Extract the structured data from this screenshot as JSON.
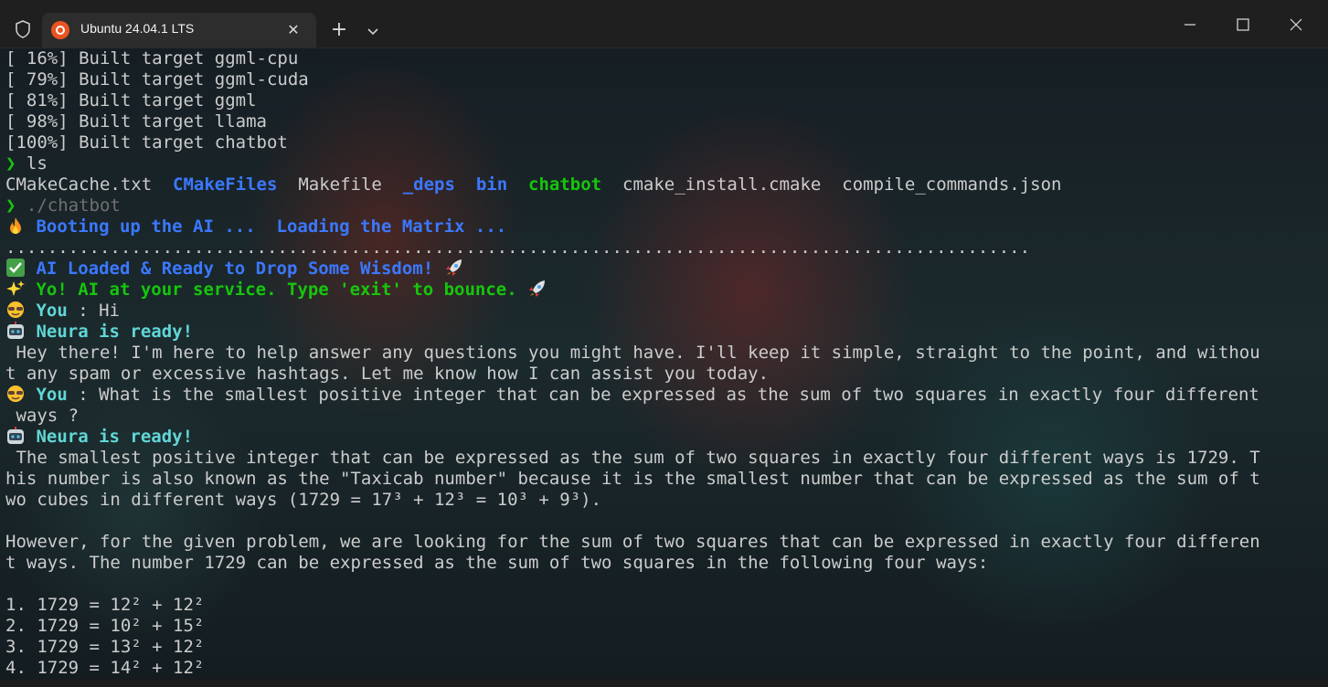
{
  "window": {
    "tab_title": "Ubuntu 24.04.1 LTS",
    "new_tab_symbol": "+",
    "close_tab_symbol": "✕"
  },
  "terminal": {
    "build_lines": [
      "[ 16%] Built target ggml-cpu",
      "[ 79%] Built target ggml-cuda",
      "[ 81%] Built target ggml",
      "[ 98%] Built target llama",
      "[100%] Built target chatbot"
    ],
    "prompt_symbol": "❯",
    "cmd1": "ls",
    "ls_output": [
      {
        "text": "CMakeCache.txt",
        "kind": "file"
      },
      {
        "text": "CMakeFiles",
        "kind": "dir"
      },
      {
        "text": "Makefile",
        "kind": "file"
      },
      {
        "text": "_deps",
        "kind": "dir"
      },
      {
        "text": "bin",
        "kind": "dir"
      },
      {
        "text": "chatbot",
        "kind": "exec"
      },
      {
        "text": "cmake_install.cmake",
        "kind": "file"
      },
      {
        "text": "compile_commands.json",
        "kind": "file"
      }
    ],
    "cmd2": "./chatbot",
    "booting": "Booting up the AI ...  Loading the Matrix ...",
    "dots": "..................................................................................................",
    "loaded": "AI Loaded & Ready to Drop Some Wisdom!",
    "welcome": "Yo! AI at your service. Type 'exit' to bounce.",
    "you_label": "You",
    "you_sep": " : ",
    "msg1": "Hi",
    "neura_label": "Neura is ready!",
    "reply1_l1": " Hey there! I'm here to help answer any questions you might have. I'll keep it simple, straight to the point, and withou",
    "reply1_l2": "t any spam or excessive hashtags. Let me know how I can assist you today.",
    "msg2_l1": "What is the smallest positive integer that can be expressed as the sum of two squares in exactly four different",
    "msg2_l2": " ways ?",
    "reply2_l1": " The smallest positive integer that can be expressed as the sum of two squares in exactly four different ways is 1729. T",
    "reply2_l2": "his number is also known as the \"Taxicab number\" because it is the smallest number that can be expressed as the sum of t",
    "reply2_l3": "wo cubes in different ways (1729 = 17³ + 12³ = 10³ + 9³).",
    "reply2_l4": "However, for the given problem, we are looking for the sum of two squares that can be expressed in exactly four differen",
    "reply2_l5": "t ways. The number 1729 can be expressed as the sum of two squares in the following four ways:",
    "list": [
      "1. 1729 = 12² + 12²",
      "2. 1729 = 10² + 15²",
      "3. 1729 = 13² + 12²",
      "4. 1729 = 14² + 12²"
    ]
  },
  "colors": {
    "dir": "#3b78ff",
    "exec": "#16c60c",
    "text": "#cccccc",
    "cyan": "#61d6d6"
  }
}
